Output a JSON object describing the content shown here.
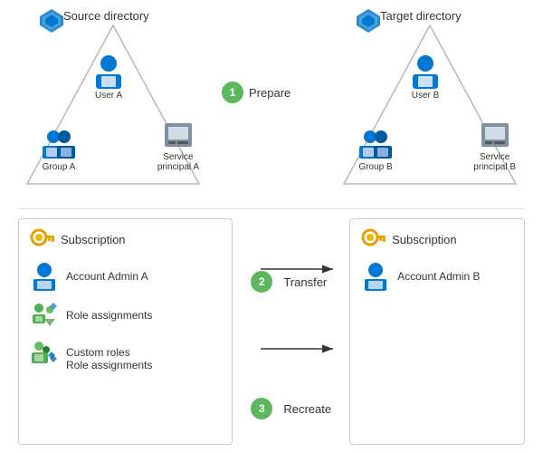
{
  "top": {
    "source": {
      "label": "Source directory",
      "user_label": "User A",
      "group_label": "Group A",
      "service_label": "Service\nprincipal A"
    },
    "target": {
      "label": "Target directory",
      "user_label": "User B",
      "group_label": "Group B",
      "service_label": "Service\nprincipal B"
    },
    "step1": {
      "number": "1",
      "label": "Prepare"
    }
  },
  "bottom": {
    "source_sub": {
      "label": "Subscription",
      "account_label": "Account Admin A",
      "roles_label": "Role assignments",
      "custom_label": "Custom roles",
      "custom_roles_sub": "Role assignments"
    },
    "target_sub": {
      "label": "Subscription",
      "account_label": "Account Admin B"
    },
    "step2": {
      "number": "2",
      "label": "Transfer"
    },
    "step3": {
      "number": "3",
      "label": "Recreate"
    }
  },
  "colors": {
    "azure_blue": "#0078d4",
    "green_step": "#5cb85c",
    "person_blue": "#0078d4",
    "group_blue": "#0078d4",
    "arrow_dark": "#333333"
  }
}
